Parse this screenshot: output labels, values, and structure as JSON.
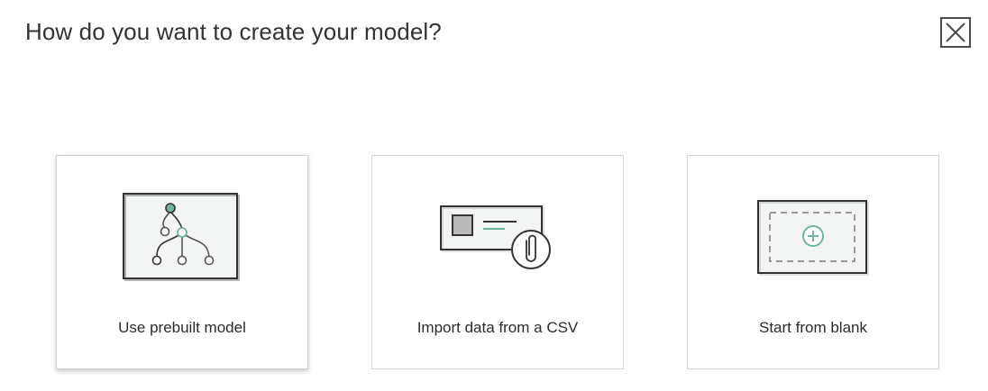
{
  "dialog": {
    "title": "How do you want to create your model?",
    "close_icon": "close-x-icon"
  },
  "options": [
    {
      "label": "Use prebuilt model",
      "icon": "model-tree-icon",
      "selected": true
    },
    {
      "label": "Import data from a CSV",
      "icon": "csv-attachment-icon",
      "selected": false
    },
    {
      "label": "Start from blank",
      "icon": "blank-add-icon",
      "selected": false
    }
  ],
  "colors": {
    "accent": "#6fb59a",
    "icon_stroke": "#333333",
    "icon_fill": "#f3f5f4",
    "card_border": "#d4d4d4"
  }
}
